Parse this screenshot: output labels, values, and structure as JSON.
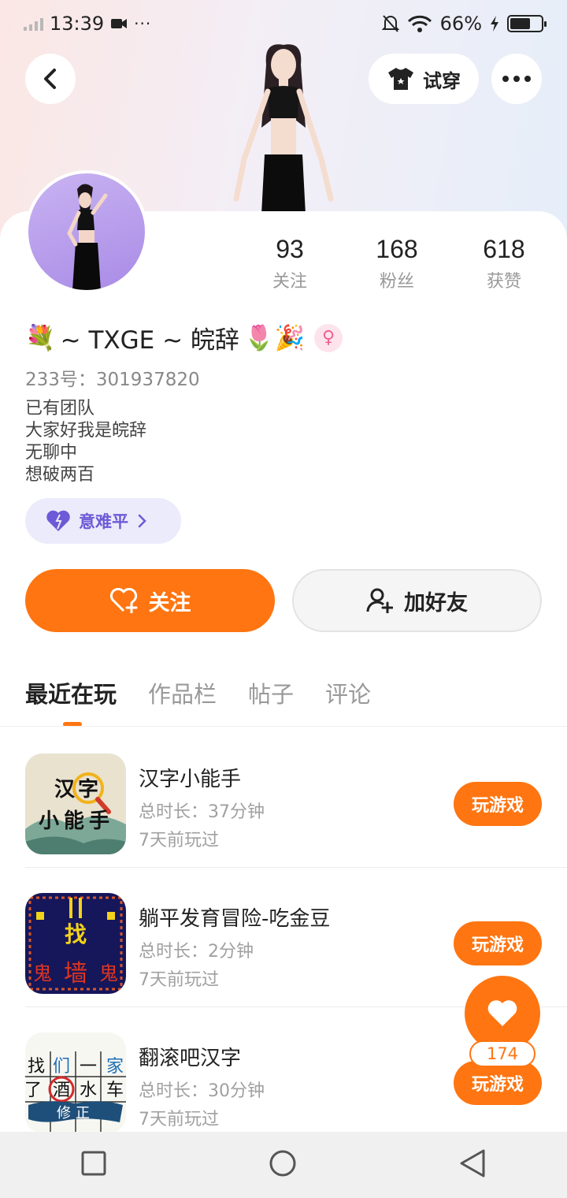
{
  "status_bar": {
    "time": "13:39",
    "battery": "66%",
    "battery_fraction": 0.66,
    "more": "···"
  },
  "header": {
    "tryon_label": "试穿"
  },
  "profile": {
    "stats": [
      {
        "value": "93",
        "label": "关注"
      },
      {
        "value": "168",
        "label": "粉丝"
      },
      {
        "value": "618",
        "label": "获赞"
      }
    ],
    "name_prefix": "💐",
    "name": "~ TXGE ~ 皖辞",
    "name_suffix": "🌷🎉",
    "gender_symbol": "♀",
    "uid": "233号：301937820",
    "bio_lines": [
      "已有团队",
      "大家好我是皖辞",
      "无聊中",
      "想破两百"
    ],
    "team_label": "意难平",
    "follow_label": "关注",
    "add_friend_label": "加好友"
  },
  "tabs": [
    "最近在玩",
    "作品栏",
    "帖子",
    "评论"
  ],
  "active_tab": 0,
  "games": [
    {
      "title": "汉字小能手",
      "duration": "总时长：37分钟",
      "last_played": "7天前玩过",
      "button": "玩游戏",
      "icon_text": [
        "汉",
        "字",
        "小",
        "能",
        "手"
      ]
    },
    {
      "title": "躺平发育冒险-吃金豆",
      "duration": "总时长：2分钟",
      "last_played": "7天前玩过",
      "button": "玩游戏",
      "icon_text": [
        "找",
        "鬼",
        "墙",
        "鬼"
      ]
    },
    {
      "title": "翻滚吧汉字",
      "duration": "总时长：30分钟",
      "last_played": "7天前玩过",
      "button": "玩游戏",
      "icon_text": [
        "找",
        "们",
        "一",
        "家",
        "了",
        "酒",
        "水",
        "车",
        "修正"
      ]
    }
  ],
  "like_count": "174",
  "colors": {
    "accent": "#ff7511",
    "team_chip_bg": "#ecebfb",
    "team_chip_text": "#6c5ad6"
  }
}
